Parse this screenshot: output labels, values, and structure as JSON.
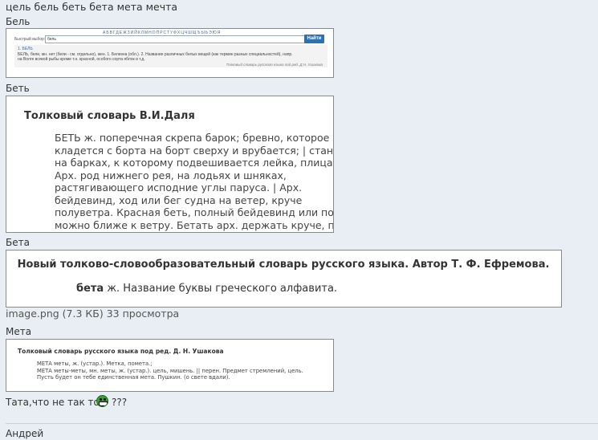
{
  "post": {
    "title_line": "цель бель беть бета мета мечта",
    "sections": [
      {
        "label": "Бель"
      },
      {
        "label": "Беть"
      },
      {
        "label": "Бета"
      },
      {
        "label": "Мета"
      }
    ],
    "attachment_caption": "image.png (7.3 КБ) 33 просмотра",
    "closing_text": "Тата,что не так то",
    "closing_suffix": "???",
    "smiley_icon": "grin-smiley"
  },
  "bel_image": {
    "alphabet": "АБВГДЕЖЗИЙКЛМНОПРСТУФХЦЧШЩЪЫЬЭЮЯ",
    "quick_label": "Быстрый выбор:",
    "input_value": "бель",
    "find_button": "Найти",
    "result_heading": "1. БЕЛЬ",
    "result_line1": "БЕЛЬ, бели, мн. нет (бели - см. отдельно), жен. 1. Белизна (обл.). 2. Название различных белых вещей (как термин разных специальностей), напр.",
    "result_line2": "на Волге всякой рыбы кроме т.н. красной, особого сорта яблок и т.д.",
    "source": "Толковый словарь русского языка под ред. Д.Н. Ушакова"
  },
  "bet_image": {
    "title": "Толковый словарь В.И.Даля",
    "lines": [
      "БЕТЬ ж. поперечная скрепа барок; бревно, которое",
      "кладется с борта на борт сверху и врубается; | станок",
      "на барках, к которому подвешивается лейка, плица. |",
      "Арх. род нижнего рея, на лодьях и шняках,",
      "растягивающего исподние углы паруса. | Арх.",
      "бейдевинд, ход или бег судна на ветер, круче",
      "полуветра. Красная беть, полный бейдевинд или почти",
      "можно ближе к ветру. Бетать арх. держать круче, прив"
    ]
  },
  "beta_image": {
    "title": "Новый толково-словообразовательный словарь русского языка. Автор Т. Ф. Ефремова.",
    "headword": "бета",
    "definition": " ж. Название буквы греческого алфавита."
  },
  "meta_image": {
    "title": "Толковый словарь русского языка под ред. Д. Н. Ушакова",
    "lines": [
      "МЕТА меты, ж. (устар.). Метка, помета.;",
      "МЕТА меты-меты, мн. меты, ж. (устар.). цель, мишень. || перен. Предмет стремлений, цель.",
      "Пусть будет он тебе единственная мета. Пушкин. (о свете вдали)."
    ]
  },
  "next_post": {
    "author": "Андрей"
  }
}
